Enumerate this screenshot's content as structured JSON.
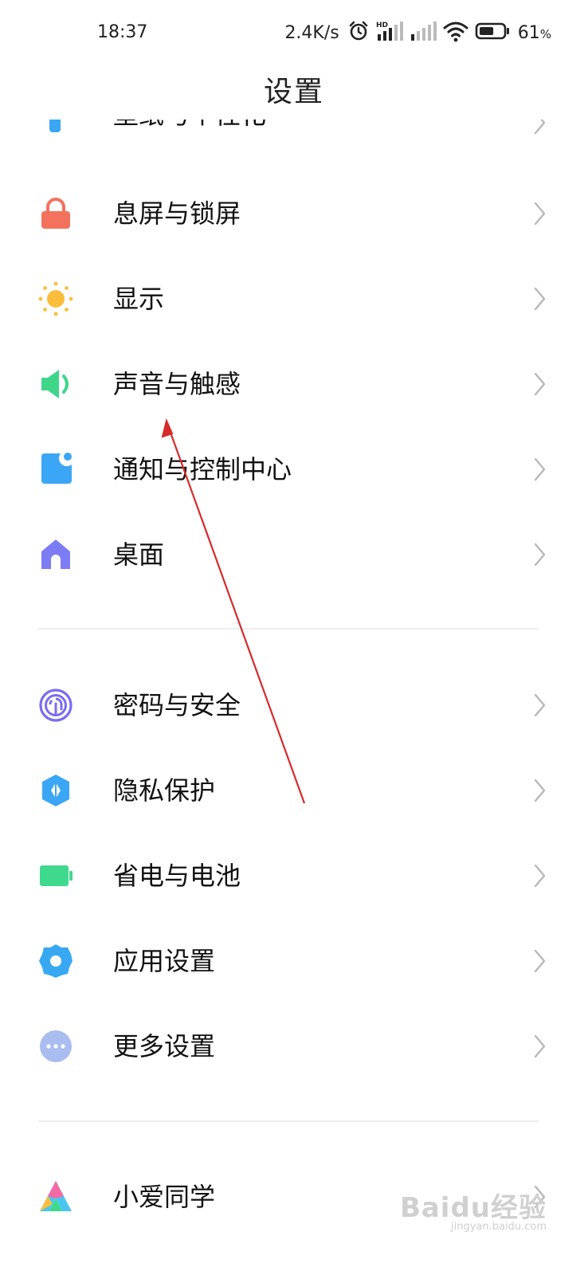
{
  "status_bar": {
    "time": "18:37",
    "net_speed": "2.4K/s",
    "hd_label": "HD",
    "battery_percent": "61",
    "battery_unit": "%",
    "battery_level": 0.61
  },
  "page_title": "设置",
  "partial_row_label": "壁纸与个性化",
  "sections": [
    {
      "items": [
        {
          "label": "息屏与锁屏",
          "icon": "lock-icon",
          "color": "#f3725d"
        },
        {
          "label": "显示",
          "icon": "sun-icon",
          "color": "#fbbe3c"
        },
        {
          "label": "声音与触感",
          "icon": "speaker-icon",
          "color": "#3fd68a"
        },
        {
          "label": "通知与控制中心",
          "icon": "notification-icon",
          "color": "#3aa6f5"
        },
        {
          "label": "桌面",
          "icon": "home-icon",
          "color": "#7c7cf4"
        }
      ]
    },
    {
      "items": [
        {
          "label": "密码与安全",
          "icon": "fingerprint-icon",
          "color": "#7a6cf0"
        },
        {
          "label": "隐私保护",
          "icon": "privacy-shield-icon",
          "color": "#3aa6f5"
        },
        {
          "label": "省电与电池",
          "icon": "battery-icon",
          "color": "#3ed98c"
        },
        {
          "label": "应用设置",
          "icon": "gear-icon",
          "color": "#39a8f2"
        },
        {
          "label": "更多设置",
          "icon": "more-icon",
          "color": "#a9bdf0"
        }
      ]
    },
    {
      "items": [
        {
          "label": "小爱同学",
          "icon": "xiaoai-icon",
          "color": "#49c6f0"
        }
      ]
    }
  ],
  "watermark": {
    "logo_text": "Baidu经验",
    "sub_text": "jingyan.baidu.com"
  }
}
